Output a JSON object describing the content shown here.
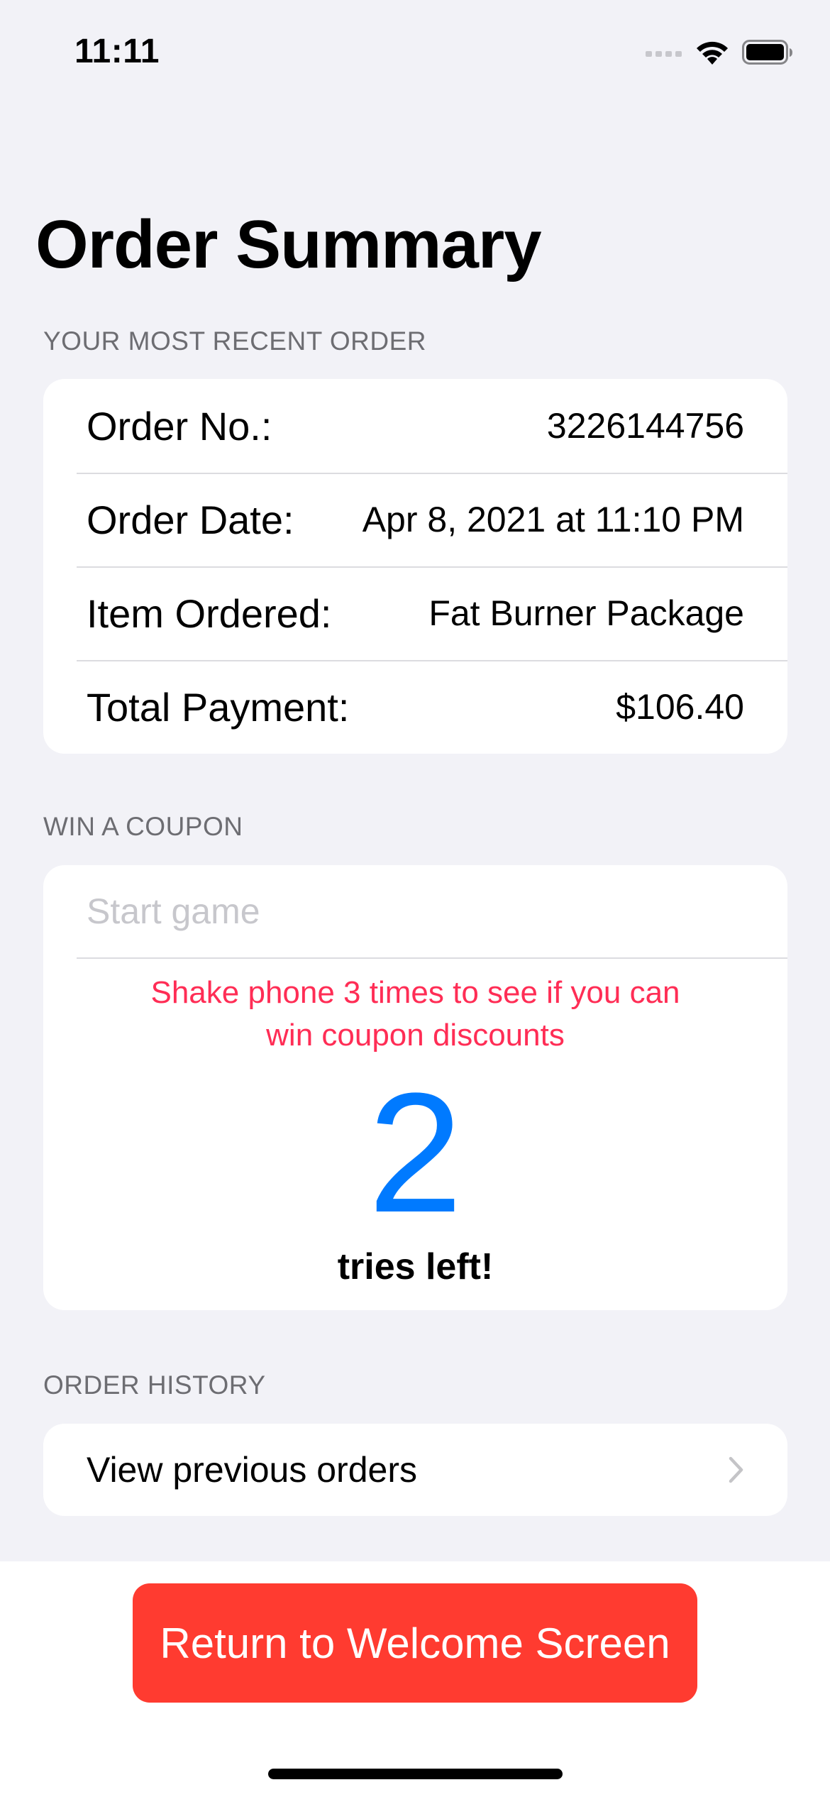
{
  "status_bar": {
    "time": "11:11",
    "icons": [
      "cellular-signal-icon",
      "wifi-icon",
      "battery-icon"
    ]
  },
  "header": {
    "title": "Order Summary"
  },
  "recent_order": {
    "section_title": "YOUR MOST RECENT ORDER",
    "rows": [
      {
        "label": "Order No.:",
        "value": "3226144756"
      },
      {
        "label": "Order Date:",
        "value": "Apr 8, 2021 at 11:10 PM"
      },
      {
        "label": "Item Ordered:",
        "value": "Fat Burner Package"
      },
      {
        "label": "Total Payment:",
        "value": "$106.40"
      }
    ]
  },
  "coupon": {
    "section_title": "WIN A COUPON",
    "input_placeholder": "Start game",
    "input_value": "",
    "instruction_line1": "Shake phone 3 times to see if you can",
    "instruction_line2": "win coupon discounts",
    "tries_count": "2",
    "tries_label": "tries left!"
  },
  "history": {
    "section_title": "ORDER HISTORY",
    "link_label": "View previous orders"
  },
  "footer": {
    "button_label": "Return to Welcome Screen"
  },
  "colors": {
    "background": "#f2f2f7",
    "card": "#ffffff",
    "accent_blue": "#007aff",
    "accent_pink": "#ff2d55",
    "button_red": "#ff3b30",
    "secondary_text": "#6d6d72",
    "placeholder": "#c7c7cc"
  }
}
